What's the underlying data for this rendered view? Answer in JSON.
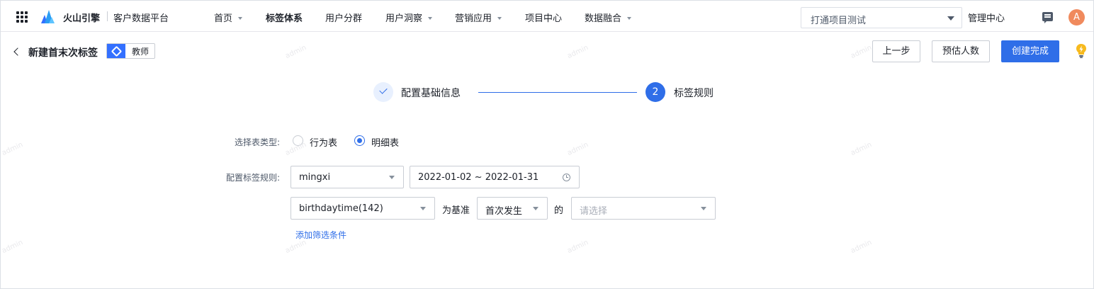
{
  "topbar": {
    "brand": "火山引擎",
    "product": "客户数据平台",
    "nav": [
      {
        "label": "首页",
        "dropdown": true,
        "active": false
      },
      {
        "label": "标签体系",
        "dropdown": false,
        "active": true
      },
      {
        "label": "用户分群",
        "dropdown": false,
        "active": false
      },
      {
        "label": "用户洞察",
        "dropdown": true,
        "active": false
      },
      {
        "label": "营销应用",
        "dropdown": true,
        "active": false
      },
      {
        "label": "项目中心",
        "dropdown": false,
        "active": false
      },
      {
        "label": "数据融合",
        "dropdown": true,
        "active": false
      }
    ],
    "project_select": "打通项目测试",
    "admin_center": "管理中心",
    "avatar_letter": "A"
  },
  "header": {
    "title": "新建首末次标签",
    "tag_chip": "教师",
    "buttons": {
      "prev": "上一步",
      "estimate": "预估人数",
      "create": "创建完成"
    }
  },
  "steps": [
    {
      "label": "配置基础信息",
      "state": "done"
    },
    {
      "number": "2",
      "label": "标签规则",
      "state": "current"
    }
  ],
  "form": {
    "table_type_label": "选择表类型:",
    "table_type_options": [
      {
        "label": "行为表",
        "checked": false
      },
      {
        "label": "明细表",
        "checked": true
      }
    ],
    "rule_label": "配置标签规则:",
    "table_select": "mingxi",
    "date_range": "2022-01-02 ~ 2022-01-31",
    "field_select": "birthdaytime(142)",
    "basis_text": "为基准",
    "occurrence_select": "首次发生",
    "of_text": "的",
    "value_placeholder": "请选择",
    "add_filter_link": "添加筛选条件"
  },
  "watermark": "admin",
  "colors": {
    "primary": "#2f6ee8",
    "avatar": "#f08a5d",
    "bulb": "#f7ba1e"
  }
}
